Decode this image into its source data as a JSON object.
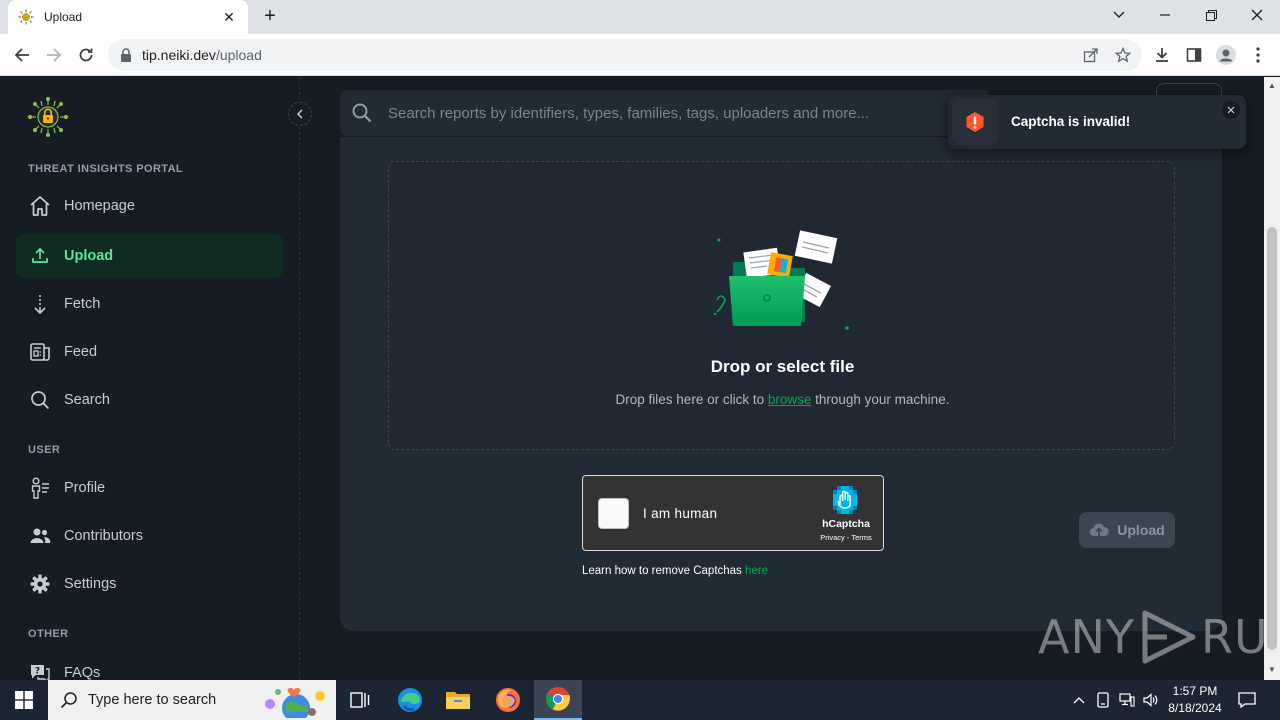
{
  "browser": {
    "tab_title": "Upload",
    "url_host": "tip.neiki.dev",
    "url_path": "/upload"
  },
  "sidebar": {
    "section_portal": "THREAT INSIGHTS PORTAL",
    "section_user": "USER",
    "section_other": "OTHER",
    "items": [
      {
        "label": "Homepage",
        "icon": "home-icon"
      },
      {
        "label": "Upload",
        "icon": "upload-icon",
        "active": true
      },
      {
        "label": "Fetch",
        "icon": "fetch-icon"
      },
      {
        "label": "Feed",
        "icon": "feed-icon"
      },
      {
        "label": "Search",
        "icon": "search-icon"
      },
      {
        "label": "Profile",
        "icon": "profile-icon"
      },
      {
        "label": "Contributors",
        "icon": "contributors-icon"
      },
      {
        "label": "Settings",
        "icon": "settings-icon"
      },
      {
        "label": "FAQs",
        "icon": "faq-icon"
      }
    ]
  },
  "search": {
    "placeholder": "Search reports by identifiers, types, families, tags, uploaders and more..."
  },
  "dropzone": {
    "title": "Drop or select file",
    "sub_before": "Drop files here or click to ",
    "browse": "browse",
    "sub_after": " through your machine."
  },
  "captcha": {
    "label": "I am human",
    "brand": "hCaptcha",
    "links": "Privacy - Terms",
    "help_text": "Learn how to remove Captchas ",
    "help_link": "here"
  },
  "upload_button": "Upload",
  "toast": {
    "message": "Captcha is invalid!",
    "status_color": "#ff5630"
  },
  "watermark": {
    "left": "ANY",
    "right": "RUN"
  },
  "taskbar": {
    "search_placeholder": "Type here to search",
    "time": "1:57 PM",
    "date": "8/18/2024"
  },
  "colors": {
    "accent": "#00ab55",
    "active_text": "#5be49b",
    "background": "#161c24",
    "surface": "#212b36"
  }
}
